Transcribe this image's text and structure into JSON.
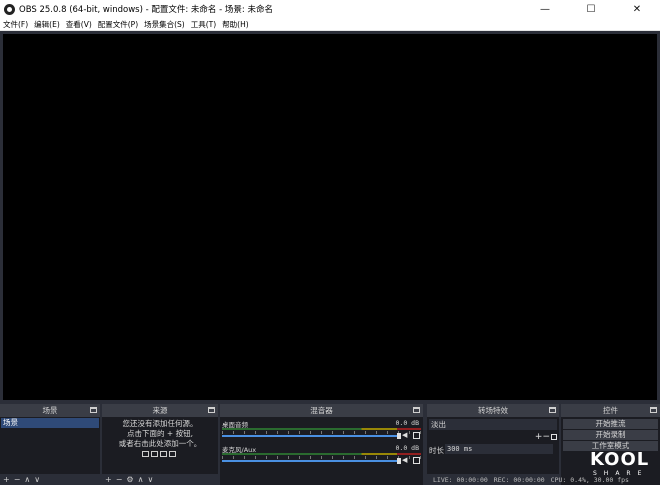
{
  "window": {
    "title": "OBS 25.0.8 (64-bit, windows) - 配置文件: 未命名 - 场景: 未命名",
    "minimize_glyph": "—",
    "maximize_glyph": "☐",
    "close_glyph": "✕"
  },
  "menu": [
    "文件(F)",
    "编辑(E)",
    "查看(V)",
    "配置文件(P)",
    "场景集合(S)",
    "工具(T)",
    "帮助(H)"
  ],
  "docks": {
    "scenes": {
      "title": "场景",
      "items": [
        "场景"
      ],
      "footer": [
        "+",
        "−",
        "∧",
        "∨"
      ]
    },
    "sources": {
      "title": "来源",
      "empty_message": [
        "您还没有添加任何源。",
        "点击下面的 + 按钮,",
        "或者右击此处添加一个。"
      ],
      "footer": [
        "+",
        "−",
        "⚙",
        "∧",
        "∨"
      ]
    },
    "mixer": {
      "title": "混音器",
      "channels": [
        {
          "name": "桌面音频",
          "db": "0.0 dB",
          "volume": 1.0
        },
        {
          "name": "麦克风/Aux",
          "db": "0.0 dB",
          "volume": 1.0
        }
      ]
    },
    "transitions": {
      "title": "转场特效",
      "selected": "淡出",
      "add_glyph": "+",
      "remove_glyph": "−",
      "duration_label": "时长",
      "duration_value": "300 ms"
    },
    "controls": {
      "title": "控件",
      "buttons": [
        "开始推流",
        "开始录制",
        "工作室模式"
      ]
    }
  },
  "status": {
    "live": "LIVE: 00:00:00",
    "rec": "REC: 00:00:00",
    "cpu": "CPU: 0.4%, 30.00 fps"
  },
  "watermark": {
    "main": "KOOL",
    "sub": "SHARE"
  },
  "colors": {
    "background": "#2b2e38",
    "dock_body": "#1b1c22",
    "selection": "#2f4a78",
    "slider": "#4a90e2"
  }
}
